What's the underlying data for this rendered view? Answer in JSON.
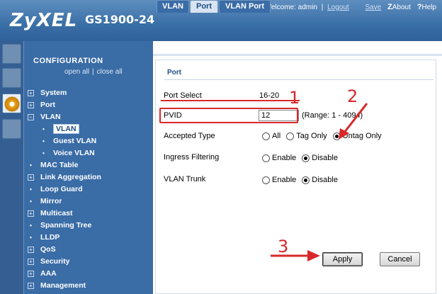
{
  "header": {
    "logo": "ZyXEL",
    "model": "GS1900-24",
    "welcome": "Welcome: admin",
    "logout": "Logout",
    "save": "Save",
    "about": "About",
    "help": "Help",
    "about_glyph": "Z",
    "help_glyph": "?"
  },
  "sidebar": {
    "title": "CONFIGURATION",
    "open_all": "open all",
    "close_all": "close all",
    "separator": "|",
    "items": [
      {
        "label": "System",
        "marker": "+"
      },
      {
        "label": "Port",
        "marker": "+"
      },
      {
        "label": "VLAN",
        "marker": "−"
      },
      {
        "label": "VLAN",
        "marker": "•"
      },
      {
        "label": "Guest VLAN",
        "marker": "•"
      },
      {
        "label": "Voice VLAN",
        "marker": "•"
      },
      {
        "label": "MAC Table",
        "marker": "•"
      },
      {
        "label": "Link Aggregation",
        "marker": "+"
      },
      {
        "label": "Loop Guard",
        "marker": "•"
      },
      {
        "label": "Mirror",
        "marker": "•"
      },
      {
        "label": "Multicast",
        "marker": "+"
      },
      {
        "label": "Spanning Tree",
        "marker": "•"
      },
      {
        "label": "LLDP",
        "marker": "•"
      },
      {
        "label": "QoS",
        "marker": "+"
      },
      {
        "label": "Security",
        "marker": "+"
      },
      {
        "label": "AAA",
        "marker": "+"
      },
      {
        "label": "Management",
        "marker": "+"
      }
    ]
  },
  "tabs": [
    {
      "label": "VLAN"
    },
    {
      "label": "Port"
    },
    {
      "label": "VLAN Port"
    }
  ],
  "panel": {
    "title": "Port",
    "port_select_label": "Port Select",
    "port_select_value": "16-20",
    "pvid_label": "PVID",
    "pvid_value": "12",
    "pvid_range": "(Range: 1 - 4094)",
    "accepted_type_label": "Accepted Type",
    "accepted_options": [
      "All",
      "Tag Only",
      "Untag Only"
    ],
    "ingress_label": "Ingress Filtering",
    "ingress_options": [
      "Enable",
      "Disable"
    ],
    "trunk_label": "VLAN Trunk",
    "trunk_options": [
      "Enable",
      "Disable"
    ],
    "apply": "Apply",
    "cancel": "Cancel"
  },
  "annotations": {
    "one": "1",
    "two": "2",
    "three": "3"
  },
  "colors": {
    "header": "#3a6fa6",
    "sidebar": "#3a6ca6",
    "annotation": "#d8282a"
  },
  "icons": [
    "gear-icon",
    "expand-icon",
    "collapse-icon",
    "bullet-icon"
  ]
}
